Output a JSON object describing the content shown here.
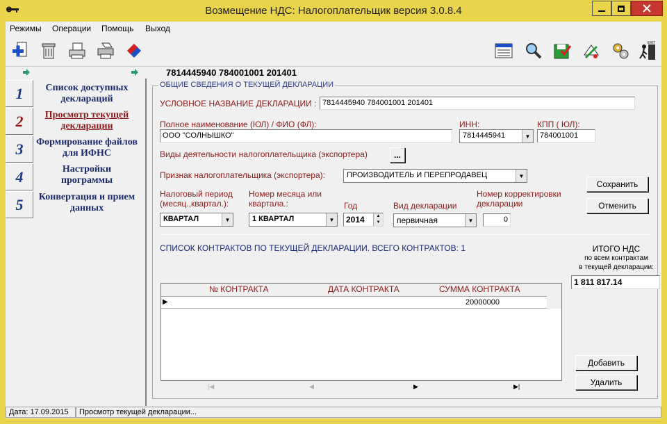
{
  "window": {
    "title": "Возмещение НДС: Налогоплательщик версия 3.0.8.4"
  },
  "menu": [
    "Режимы",
    "Операции",
    "Помощь",
    "Выход"
  ],
  "toolbar_left": [
    "new-document-icon",
    "delete-icon",
    "print-preview-icon",
    "print-icon",
    "convert-icon"
  ],
  "toolbar_right": [
    "form-icon",
    "search-icon",
    "save-check-icon",
    "sign-icon",
    "settings-icon",
    "exit-icon"
  ],
  "exit_icon_text": "EXIT",
  "header": {
    "code": "7814445940 784001001 201401"
  },
  "nav": [
    {
      "num": "1",
      "label": "Список доступных деклараций"
    },
    {
      "num": "2",
      "label": "Просмотр текущей декларации"
    },
    {
      "num": "3",
      "label": "Формирование файлов для ИФНС"
    },
    {
      "num": "4",
      "label": "Настройки программы"
    },
    {
      "num": "5",
      "label": "Конвертация и прием данных"
    }
  ],
  "section_title": "ОБЩИЕ СВЕДЕНИЯ О ТЕКУЩЕЙ ДЕКЛАРАЦИИ",
  "form": {
    "decl_name_label": "УСЛОВНОЕ НАЗВАНИЕ ДЕКЛАРАЦИИ :",
    "decl_name_value": "7814445940 784001001 201401",
    "fullname_label": "Полное наименование (ЮЛ) / ФИО (ФЛ):",
    "fullname_value": "ООО \"СОЛНЫШКО\"",
    "inn_label": "ИНН:",
    "inn_value": "7814445941",
    "kpp_label": "КПП ( ЮЛ):",
    "kpp_value": "784001001",
    "activity_label": "Виды деятельности налогоплательщика (экспортера)",
    "activity_button": "...",
    "sign_label": "Признак налогоплательщика (экспортера):",
    "sign_value": "ПРОИЗВОДИТЕЛЬ И ПЕРЕПРОДАВЕЦ",
    "period_label": "Налоговый период (месяц.,квартал.):",
    "period_value": "КВАРТАЛ",
    "number_label": "Номер месяца или квартала.:",
    "number_value": "1 КВАРТАЛ",
    "year_label": "Год",
    "year_value": "2014",
    "type_label": "Вид декларации",
    "type_value": "первичная",
    "corr_label": "Номер корректировки декларации",
    "corr_value": "0",
    "save_button": "Сохранить",
    "cancel_button": "Отменить"
  },
  "contracts": {
    "title": "СПИСОК КОНТРАКТОВ ПО ТЕКУЩЕЙ ДЕКЛАРАЦИИ. ВСЕГО КОНТРАКТОВ: 1",
    "columns": [
      "№ КОНТРАКТА",
      "ДАТА КОНТРАКТА",
      "СУММА КОНТРАКТА"
    ],
    "rows": [
      {
        "number": "",
        "date": "",
        "sum": "20000000"
      }
    ],
    "nav": [
      "|◀",
      "◀",
      "▶",
      "▶|"
    ],
    "add_button": "Добавить",
    "delete_button": "Удалить"
  },
  "total": {
    "title": "ИТОГО НДС",
    "sub1": "по всем контрактам",
    "sub2": "в текущей декларации:",
    "value": "1 811 817.14"
  },
  "status": {
    "date": "Дата: 17.09.2015",
    "mode": "Просмотр текущей  декларации..."
  },
  "colors": {
    "titlebar": "#e9d44b",
    "nav_text": "#1a2a6a",
    "label_red": "#8b1a1a"
  }
}
